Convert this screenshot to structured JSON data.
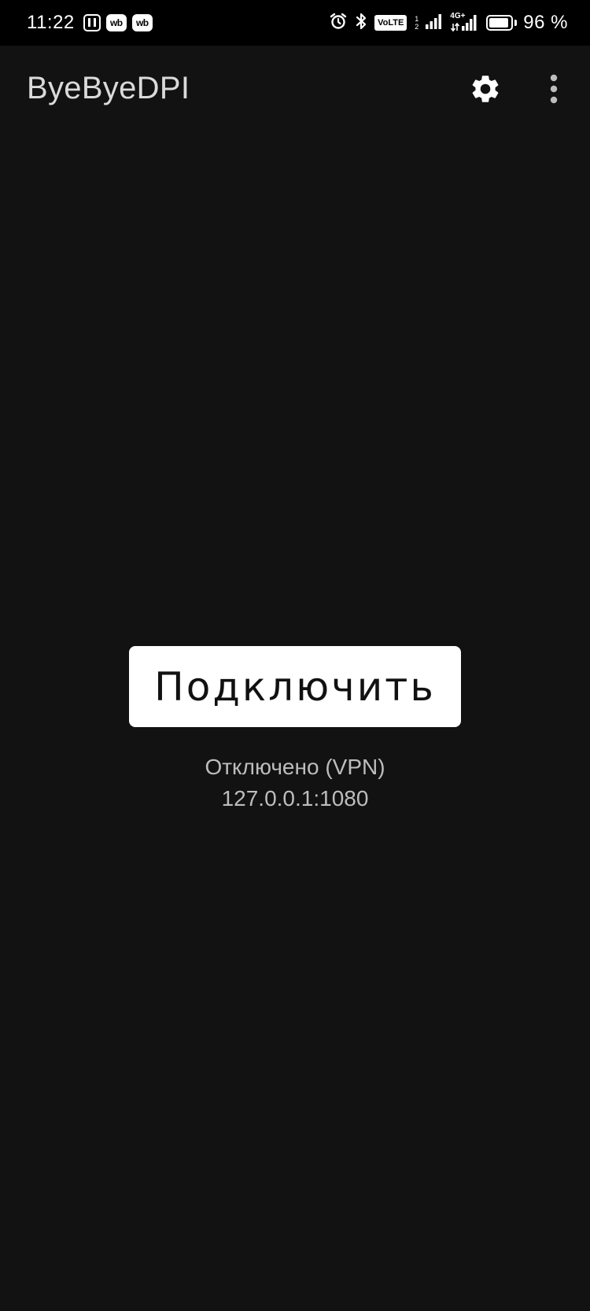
{
  "status_bar": {
    "time": "11:22",
    "wb_badges": [
      "wb",
      "wb"
    ],
    "volte_label": "VoLTE",
    "volte_sim_top": "1",
    "volte_sim_bottom": "2",
    "network_label": "4G+",
    "battery_percent": 96,
    "battery_text": "96 %"
  },
  "app_bar": {
    "title": "ByeByeDPI"
  },
  "main": {
    "connect_label": "Подключить",
    "status_text": "Отключено (VPN)",
    "address": "127.0.0.1:1080"
  },
  "icons": {
    "settings": "gear-icon",
    "more": "more-vert-icon",
    "alarm": "alarm-icon",
    "bluetooth": "bluetooth-icon",
    "nfc": "nfc-icon"
  },
  "colors": {
    "background": "#121212",
    "status_bar": "#000000",
    "button_bg": "#ffffff",
    "button_text": "#111111",
    "title": "#dadada",
    "status_text": "#bdbdbd"
  }
}
